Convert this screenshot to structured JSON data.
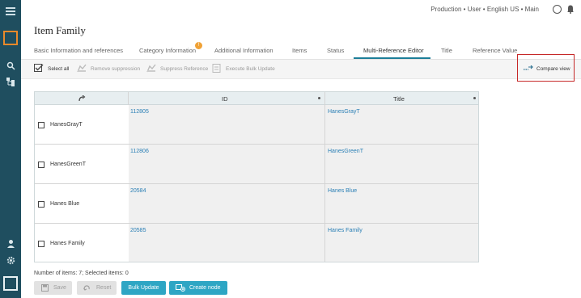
{
  "header": {
    "context": "Production • User  • English US • Main"
  },
  "page": {
    "title": "Item Family"
  },
  "tabs": [
    {
      "label": "Basic Information and references"
    },
    {
      "label": "Category Information",
      "badge": "!"
    },
    {
      "label": "Additional Information"
    },
    {
      "label": "Items"
    },
    {
      "label": "Status"
    },
    {
      "label": "Multi-Reference Editor",
      "active": true
    },
    {
      "label": "Title"
    },
    {
      "label": "Reference Value"
    }
  ],
  "toolbar": {
    "select_all": "Select all",
    "remove_suppression": "Remove suppression",
    "suppress_reference": "Suppress Reference",
    "execute_bulk_update": "Execute Bulk Update",
    "compare_view": "Compare view"
  },
  "grid": {
    "columns": [
      "ID",
      "Title"
    ],
    "rows": [
      {
        "name": "HanesGrayT",
        "id": "112805",
        "title": "HanesGrayT"
      },
      {
        "name": "HanesGreenT",
        "id": "112806",
        "title": "HanesGreenT"
      },
      {
        "name": "Hanes Blue",
        "id": "20584",
        "title": "Hanes Blue"
      },
      {
        "name": "Hanes Family",
        "id": "20585",
        "title": "Hanes Family"
      }
    ]
  },
  "footer": {
    "count_text": "Number of items: 7; Selected items: 0",
    "save": "Save",
    "reset": "Reset",
    "bulk_update": "Bulk Update",
    "create_node": "Create node"
  },
  "colors": {
    "rail": "#1f4e5f",
    "accent": "#2ea6c4",
    "link": "#2a7fb5",
    "highlight": "#c62828",
    "badge": "#f0a236"
  },
  "icons": [
    "menu-icon",
    "search-icon",
    "hierarchy-icon",
    "user-icon",
    "gear-icon",
    "moon-icon",
    "bell-icon",
    "checkbox-icon",
    "refresh-icon",
    "compare-icon",
    "save-icon",
    "reset-icon",
    "create-node-icon"
  ]
}
